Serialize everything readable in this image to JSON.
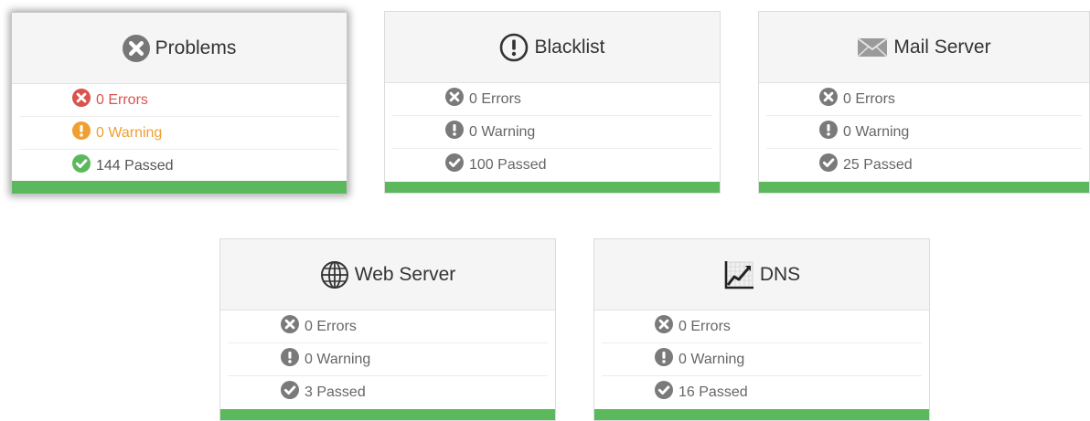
{
  "colors": {
    "accent": "#5cb85c",
    "error": "#d9534f",
    "warning": "#f0a030",
    "success": "#5cb85c",
    "neutral": "#7a7a7a"
  },
  "cards": [
    {
      "title": "Problems",
      "icon": "close-circle-icon",
      "errors": "0 Errors",
      "warnings": "0 Warning",
      "passed": "144 Passed",
      "selected": true
    },
    {
      "title": "Blacklist",
      "icon": "exclamation-circle-icon",
      "errors": "0 Errors",
      "warnings": "0 Warning",
      "passed": "100 Passed"
    },
    {
      "title": "Mail Server",
      "icon": "envelope-icon",
      "errors": "0 Errors",
      "warnings": "0 Warning",
      "passed": "25 Passed"
    },
    {
      "title": "Web Server",
      "icon": "globe-icon",
      "errors": "0 Errors",
      "warnings": "0 Warning",
      "passed": "3 Passed"
    },
    {
      "title": "DNS",
      "icon": "chart-icon",
      "errors": "0 Errors",
      "warnings": "0 Warning",
      "passed": "16 Passed"
    }
  ]
}
